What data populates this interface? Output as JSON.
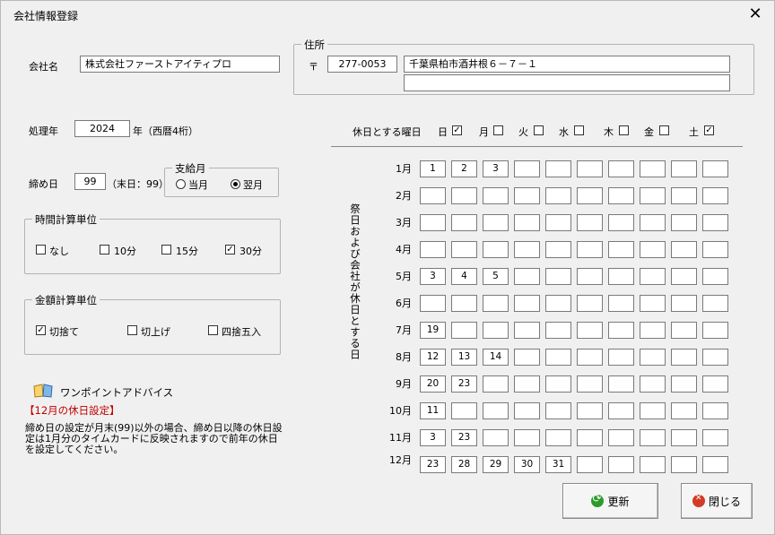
{
  "window": {
    "title": "会社情報登録",
    "close_label": "✕"
  },
  "company": {
    "label": "会社名",
    "value": "株式会社ファーストアイティプロ"
  },
  "address": {
    "legend": "住所",
    "postal_mark": "〒",
    "postal_code": "277-0053",
    "line1": "千葉県柏市酒井根６－７－１",
    "line2": ""
  },
  "year": {
    "label": "処理年",
    "value": "2024",
    "suffix": "年（西暦4桁）"
  },
  "closing": {
    "label": "締め日",
    "value": "99",
    "note": "（末日：99）",
    "pay_group": {
      "legend": "支給月",
      "options": [
        "当月",
        "翌月"
      ],
      "selected": 1
    }
  },
  "time_unit": {
    "legend": "時間計算単位",
    "options": [
      {
        "label": "なし",
        "checked": false
      },
      {
        "label": "10分",
        "checked": false
      },
      {
        "label": "15分",
        "checked": false
      },
      {
        "label": "30分",
        "checked": true
      }
    ]
  },
  "money_unit": {
    "legend": "金額計算単位",
    "options": [
      {
        "label": "切捨て",
        "checked": true
      },
      {
        "label": "切上げ",
        "checked": false
      },
      {
        "label": "四捨五入",
        "checked": false
      }
    ]
  },
  "advice": {
    "title": "ワンポイントアドバイス",
    "heading": "【12月の休日設定】",
    "body": "締め日の設定が月末(99)以外の場合、締め日以降の休日設定は1月分のタイムカードに反映されますので前年の休日を設定してください。"
  },
  "holidays": {
    "label": "休日とする曜日",
    "days": [
      {
        "label": "日",
        "checked": true
      },
      {
        "label": "月",
        "checked": false
      },
      {
        "label": "火",
        "checked": false
      },
      {
        "label": "水",
        "checked": false
      },
      {
        "label": "木",
        "checked": false
      },
      {
        "label": "金",
        "checked": false
      },
      {
        "label": "土",
        "checked": true
      }
    ],
    "vertical_label": "祭日および会社が休日とする日",
    "months": [
      {
        "label": "1月",
        "cells": [
          "1",
          "2",
          "3",
          "",
          "",
          "",
          "",
          "",
          "",
          ""
        ]
      },
      {
        "label": "2月",
        "cells": [
          "",
          "",
          "",
          "",
          "",
          "",
          "",
          "",
          "",
          ""
        ]
      },
      {
        "label": "3月",
        "cells": [
          "",
          "",
          "",
          "",
          "",
          "",
          "",
          "",
          "",
          ""
        ]
      },
      {
        "label": "4月",
        "cells": [
          "",
          "",
          "",
          "",
          "",
          "",
          "",
          "",
          "",
          ""
        ]
      },
      {
        "label": "5月",
        "cells": [
          "3",
          "4",
          "5",
          "",
          "",
          "",
          "",
          "",
          "",
          ""
        ]
      },
      {
        "label": "6月",
        "cells": [
          "",
          "",
          "",
          "",
          "",
          "",
          "",
          "",
          "",
          ""
        ]
      },
      {
        "label": "7月",
        "cells": [
          "19",
          "",
          "",
          "",
          "",
          "",
          "",
          "",
          "",
          ""
        ]
      },
      {
        "label": "8月",
        "cells": [
          "12",
          "13",
          "14",
          "",
          "",
          "",
          "",
          "",
          "",
          ""
        ]
      },
      {
        "label": "9月",
        "cells": [
          "20",
          "23",
          "",
          "",
          "",
          "",
          "",
          "",
          "",
          ""
        ]
      },
      {
        "label": "10月",
        "cells": [
          "11",
          "",
          "",
          "",
          "",
          "",
          "",
          "",
          "",
          ""
        ]
      },
      {
        "label": "11月",
        "cells": [
          "3",
          "23",
          "",
          "",
          "",
          "",
          "",
          "",
          "",
          ""
        ]
      },
      {
        "label": "12月",
        "cells": [
          "23",
          "28",
          "29",
          "30",
          "31",
          "",
          "",
          "",
          "",
          ""
        ]
      }
    ]
  },
  "buttons": {
    "update": "更新",
    "close": "閉じる"
  }
}
